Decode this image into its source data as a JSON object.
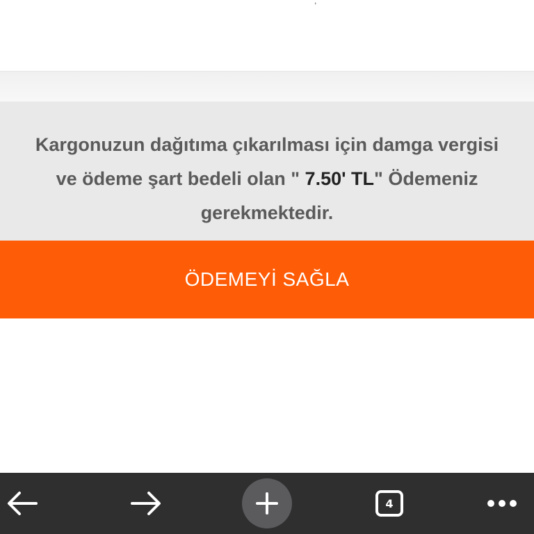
{
  "message": {
    "text_before": "Kargonuzun dağıtıma çıkarılması için damga vergisi ve ödeme şart bedeli olan \" ",
    "amount": "7.50' TL",
    "text_after": "\" Ödemeniz gerekmektedir."
  },
  "pay_button": {
    "label": "ÖDEMEYİ SAĞLA"
  },
  "toolbar": {
    "tab_count": "4",
    "icons": {
      "back": "arrow-left-icon",
      "forward": "arrow-right-icon",
      "new_tab": "plus-icon",
      "tabs": "tab-count-icon",
      "more": "more-dots-icon"
    }
  },
  "colors": {
    "accent": "#ff5c07",
    "message_bg": "#e9e9e9",
    "toolbar_bg": "#2f2f30"
  }
}
